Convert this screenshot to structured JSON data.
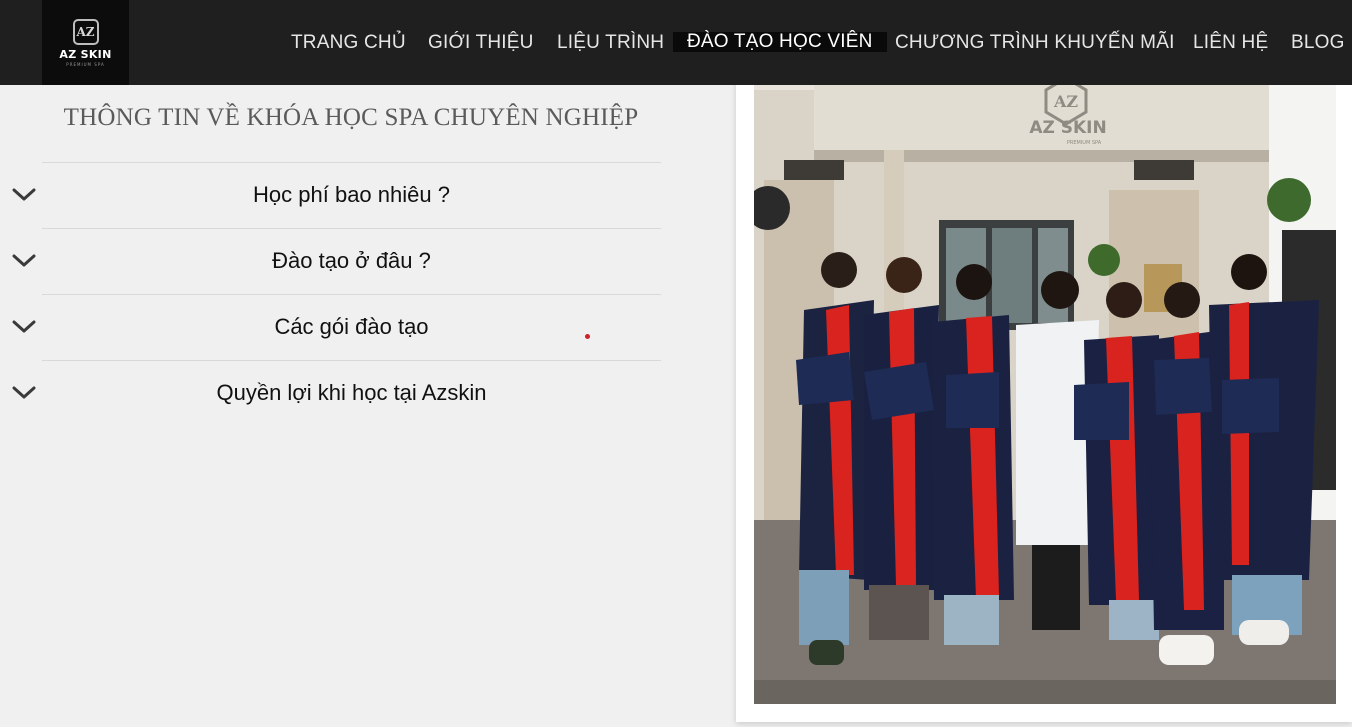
{
  "brand": {
    "logo_mark": "AZ",
    "logo_name": "AZ SKIN",
    "logo_sub": "PREMIUM SPA"
  },
  "nav": {
    "items": [
      {
        "label": "TRANG CHỦ"
      },
      {
        "label": "GIỚI THIỆU"
      },
      {
        "label": "LIỆU TRÌNH"
      },
      {
        "label": "ĐÀO TẠO HỌC VIÊN",
        "active": true
      },
      {
        "label": "CHƯƠNG TRÌNH KHUYẾN MÃI"
      },
      {
        "label": "LIÊN HỆ"
      },
      {
        "label": "BLOG"
      }
    ]
  },
  "section": {
    "title": "THÔNG TIN VỀ KHÓA HỌC SPA CHUYÊN NGHIỆP"
  },
  "accordion": {
    "items": [
      {
        "label": "Học phí bao nhiêu ?"
      },
      {
        "label": "Đào tạo ở đâu ?"
      },
      {
        "label": "Các gói đào tạo"
      },
      {
        "label": "Quyền lợi khi học tại Azskin"
      }
    ]
  },
  "photo": {
    "sign_mark": "AZ",
    "sign_name": "AZ SKIN",
    "sign_sub": "PREMIUM SPA"
  },
  "colors": {
    "header_bg": "#1f1f1f",
    "page_bg": "#f0f0f0",
    "accent_red": "#d0202a"
  }
}
